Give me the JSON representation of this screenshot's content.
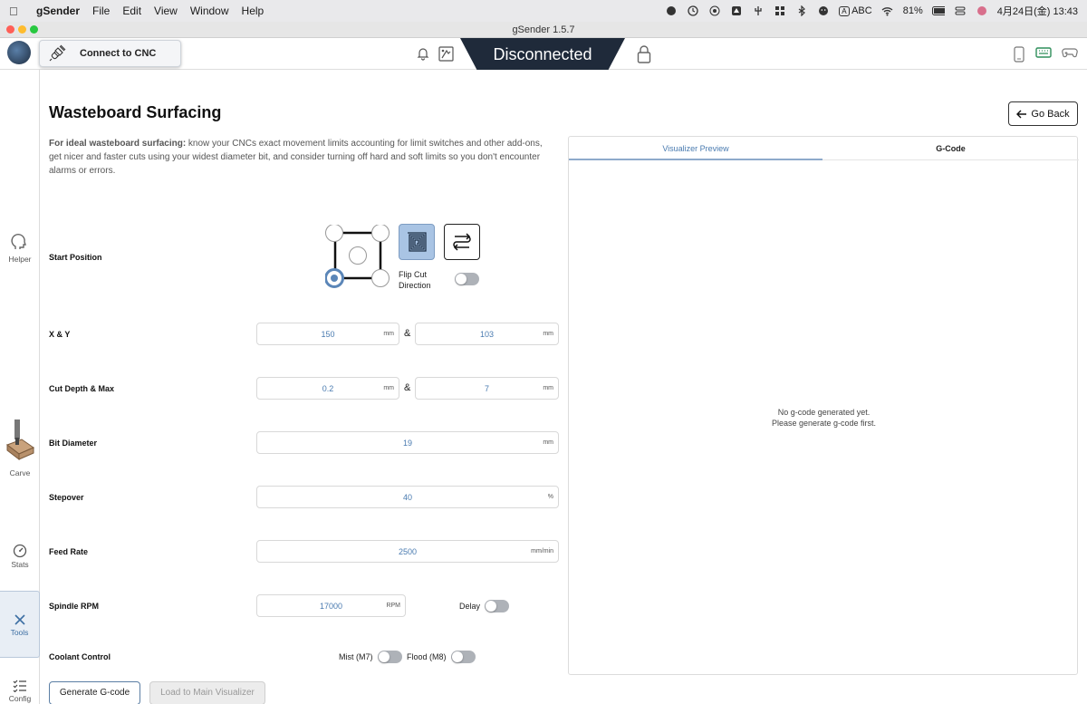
{
  "menubar": {
    "app_name": "gSender",
    "items": [
      "File",
      "Edit",
      "View",
      "Window",
      "Help"
    ],
    "input_source": "ABC",
    "battery": "81%",
    "datetime": "4月24日(金)  13:43"
  },
  "window": {
    "title": "gSender 1.5.7"
  },
  "topbar": {
    "connect_label": "Connect to CNC",
    "status": "Disconnected",
    "status_color": "#1f2a3a"
  },
  "sidebar": {
    "helper": "Helper",
    "carve": "Carve",
    "stats": "Stats",
    "tools": "Tools",
    "config": "Config"
  },
  "page": {
    "title": "Wasteboard Surfacing",
    "go_back": "Go Back",
    "intro_bold": "For ideal wasteboard surfacing:",
    "intro_text": " know your CNCs exact movement limits accounting for limit switches and other add-ons, get nicer and faster cuts using your widest diameter bit, and consider turning off hard and soft limits so you don't encounter alarms or errors."
  },
  "form": {
    "start_position": {
      "label": "Start Position",
      "flip_label": "Flip Cut Direction",
      "flip_on": false,
      "selected_corner": "bottom-left",
      "selected_pattern": "spiral"
    },
    "xy": {
      "label": "X & Y",
      "x": "150",
      "y": "103",
      "unit": "mm",
      "sep": "&"
    },
    "cut_depth": {
      "label": "Cut Depth & Max",
      "depth": "0.2",
      "max": "7",
      "unit": "mm",
      "sep": "&"
    },
    "bit_diameter": {
      "label": "Bit Diameter",
      "value": "19",
      "unit": "mm"
    },
    "stepover": {
      "label": "Stepover",
      "value": "40",
      "unit": "%"
    },
    "feed_rate": {
      "label": "Feed Rate",
      "value": "2500",
      "unit": "mm/min"
    },
    "spindle": {
      "label": "Spindle RPM",
      "value": "17000",
      "unit": "RPM",
      "delay_label": "Delay",
      "delay_on": false
    },
    "coolant": {
      "label": "Coolant Control",
      "mist_label": "Mist (M7)",
      "mist_on": false,
      "flood_label": "Flood (M8)",
      "flood_on": false
    }
  },
  "actions": {
    "generate": "Generate G-code",
    "load": "Load to Main Visualizer"
  },
  "preview": {
    "tab_visualizer": "Visualizer Preview",
    "tab_gcode": "G-Code",
    "empty_line1": "No g-code generated yet.",
    "empty_line2": "Please generate g-code first."
  }
}
